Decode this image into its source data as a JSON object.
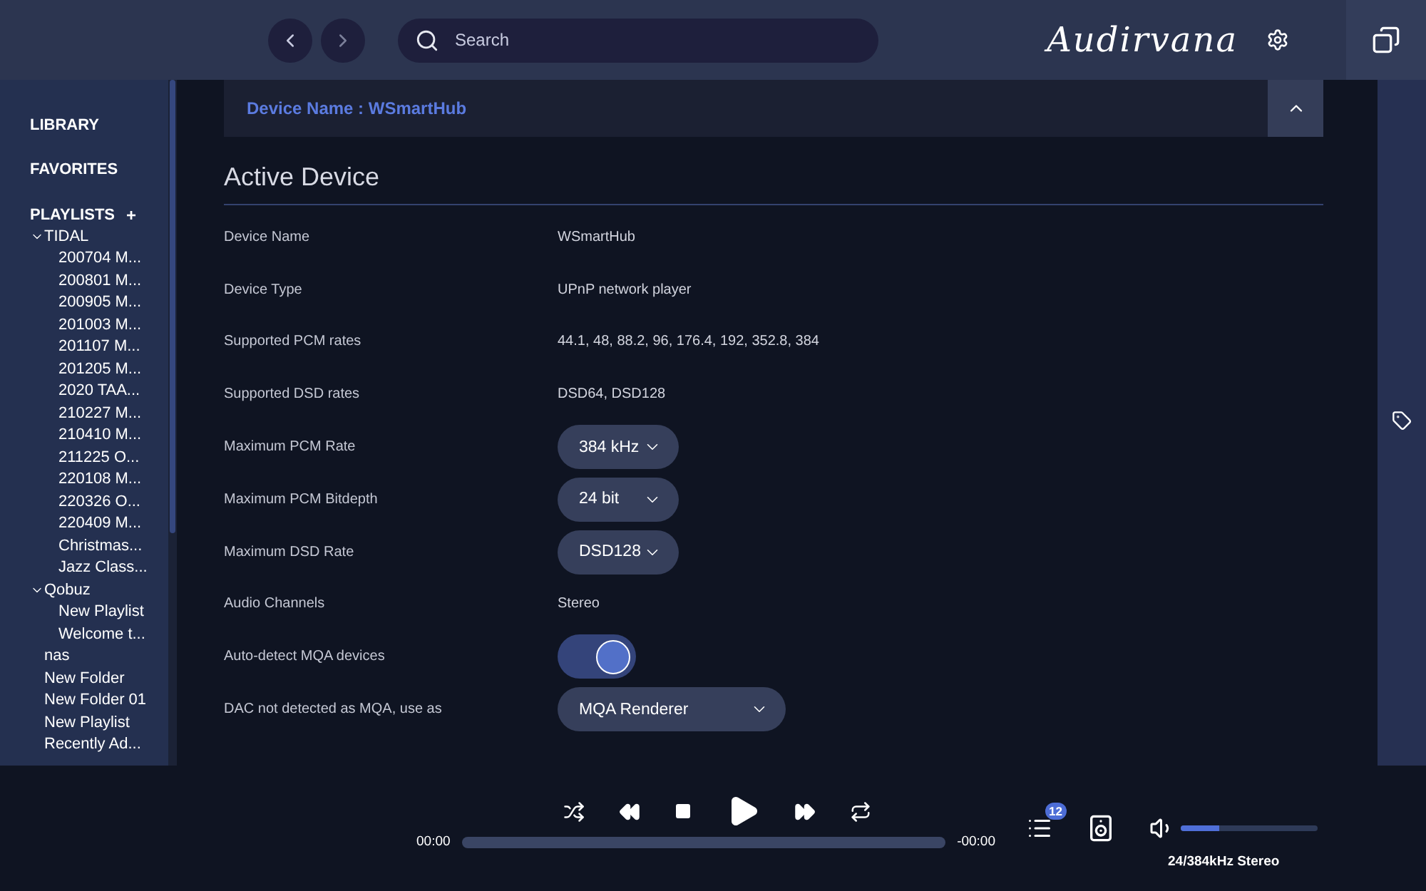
{
  "topbar": {
    "search": {
      "placeholder": "Search"
    },
    "logo": "Audirvana"
  },
  "sidebar": {
    "sections": [
      {
        "label": "LIBRARY"
      },
      {
        "label": "FAVORITES"
      }
    ],
    "playlists": {
      "label": "PLAYLISTS",
      "add": "+",
      "items": [
        {
          "label": "TIDAL",
          "expanded": true,
          "children": [
            {
              "label": "200704 M..."
            },
            {
              "label": "200801 M..."
            },
            {
              "label": "200905 M..."
            },
            {
              "label": "201003 M..."
            },
            {
              "label": "201107 M..."
            },
            {
              "label": "201205 M..."
            },
            {
              "label": "2020 TAA..."
            },
            {
              "label": "210227 M..."
            },
            {
              "label": "210410 M..."
            },
            {
              "label": "211225 O..."
            },
            {
              "label": "220108 M..."
            },
            {
              "label": "220326 O..."
            },
            {
              "label": "220409 M..."
            },
            {
              "label": "Christmas..."
            },
            {
              "label": "Jazz Class..."
            }
          ]
        },
        {
          "label": "Qobuz",
          "expanded": true,
          "children": [
            {
              "label": "New Playlist"
            },
            {
              "label": "Welcome t..."
            }
          ]
        },
        {
          "label": "nas"
        },
        {
          "label": "New Folder"
        },
        {
          "label": "New Folder 01"
        },
        {
          "label": "New Playlist"
        },
        {
          "label": "Recently Ad..."
        }
      ]
    }
  },
  "device_header": {
    "title": "Device Name : WSmartHub",
    "expanded": true
  },
  "section_title": "Active Device",
  "rows": [
    {
      "kind": "text",
      "label": "Device Name",
      "value": "WSmartHub"
    },
    {
      "kind": "text",
      "label": "Device Type",
      "value": "UPnP network player"
    },
    {
      "kind": "text",
      "label": "Supported PCM rates",
      "value": "44.1, 48, 88.2, 96, 176.4, 192, 352.8, 384"
    },
    {
      "kind": "text",
      "label": "Supported DSD rates",
      "value": "DSD64, DSD128"
    },
    {
      "kind": "select",
      "label": "Maximum PCM Rate",
      "value": "384 kHz"
    },
    {
      "kind": "select",
      "label": "Maximum PCM Bitdepth",
      "value": "24 bit"
    },
    {
      "kind": "select",
      "label": "Maximum DSD Rate",
      "value": "DSD128"
    },
    {
      "kind": "text",
      "label": "Audio Channels",
      "value": "Stereo"
    },
    {
      "kind": "toggle",
      "label": "Auto-detect MQA devices",
      "on": true
    },
    {
      "kind": "wide-select",
      "label": "DAC not detected as MQA, use as",
      "value": "MQA Renderer"
    }
  ],
  "player": {
    "elapsed": "00:00",
    "remaining": "-00:00",
    "progress": {
      "level": 0
    },
    "queue_count": "12",
    "volume": {
      "level": 0.28
    },
    "format": "24/384kHz Stereo"
  }
}
